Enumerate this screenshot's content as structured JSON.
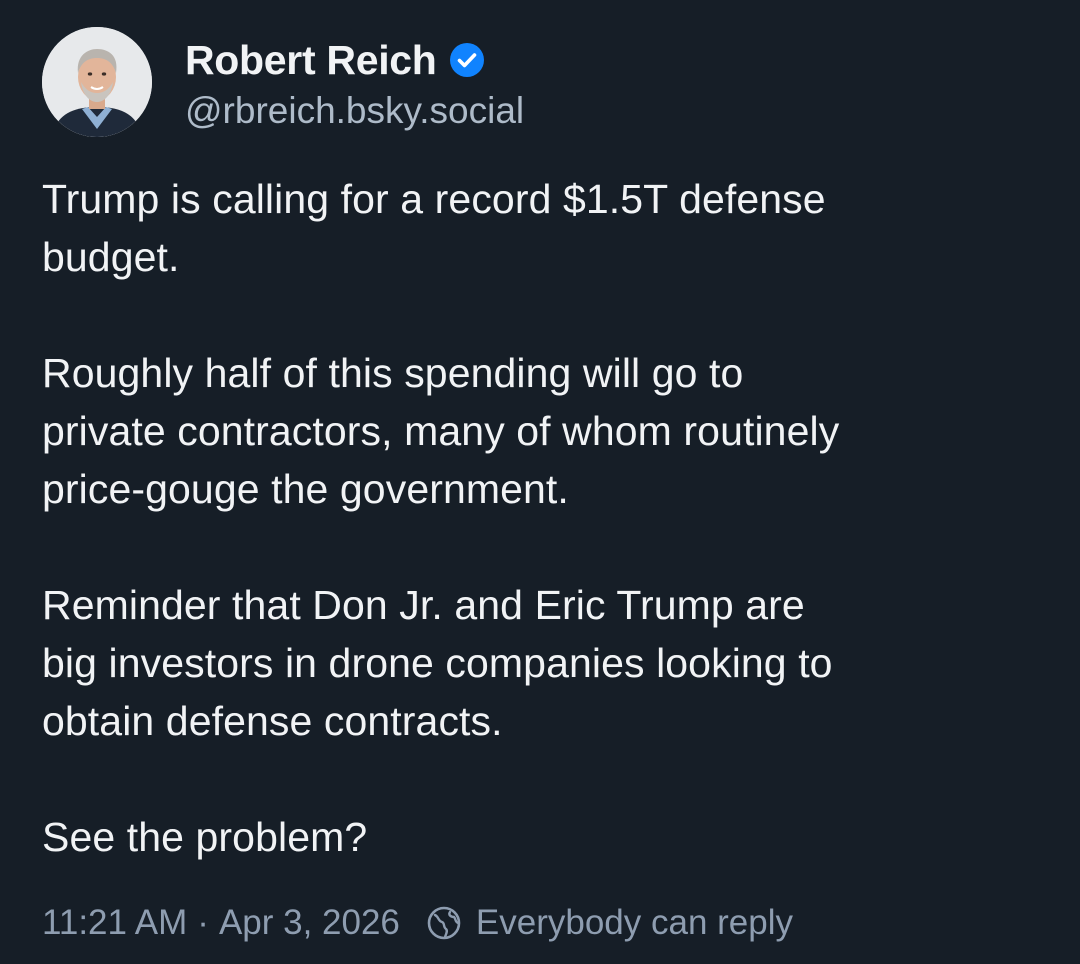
{
  "author": {
    "display_name": "Robert Reich",
    "handle": "@rbreich.bsky.social",
    "verified": true,
    "avatar_icon": "profile-photo"
  },
  "post": {
    "paragraphs": [
      "Trump is calling for a record $1.5T defense\nbudget.",
      "Roughly half of this spending will go to\nprivate contractors, many of whom routinely\nprice-gouge the government.",
      "Reminder that Don Jr. and Eric Trump are\nbig investors in drone companies looking to\nobtain defense contracts.",
      "See the problem?"
    ]
  },
  "meta": {
    "time": "11:21 AM",
    "separator": "·",
    "date": "Apr 3, 2026",
    "reply_setting": "Everybody can reply",
    "reply_icon": "globe-icon"
  },
  "colors": {
    "background": "#161e27",
    "text": "#f1f3f5",
    "handle": "#aebbc9",
    "meta": "#8e9db0",
    "verified_badge": "#1083fe"
  }
}
